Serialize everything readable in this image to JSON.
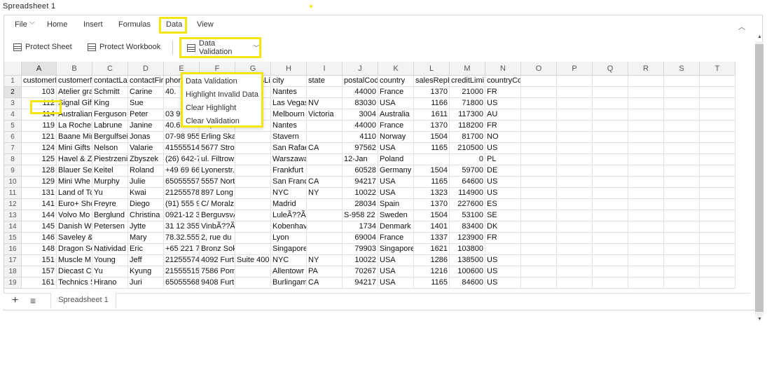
{
  "app": {
    "title": "Spreadsheet 1"
  },
  "menu": {
    "items": [
      "File",
      "Home",
      "Insert",
      "Formulas",
      "Data",
      "View"
    ],
    "active": "Data"
  },
  "toolbar": {
    "protect_sheet": "Protect Sheet",
    "protect_workbook": "Protect Workbook",
    "data_validation": "Data Validation"
  },
  "dropdown": {
    "items": [
      "Data Validation",
      "Highlight Invalid Data",
      "Clear Highlight",
      "Clear Validation"
    ]
  },
  "columns": [
    "A",
    "B",
    "C",
    "D",
    "E",
    "F",
    "G",
    "H",
    "I",
    "J",
    "K",
    "L",
    "M",
    "N",
    "O",
    "P",
    "Q",
    "R",
    "S",
    "T"
  ],
  "rows": [
    [
      "customerN",
      "customerN",
      "contactLa",
      "contactFir",
      "phone",
      "addressLi",
      "addressLi",
      "city",
      "state",
      "postalCod",
      "country",
      "salesRepE",
      "creditLimi",
      "countryCo"
    ],
    [
      "103",
      "Atelier gra",
      "Schmitt",
      "Carine",
      "40.",
      "",
      "",
      "Nantes",
      "",
      "44000",
      "France",
      "1370",
      "21000",
      "FR"
    ],
    [
      "112",
      "Signal Gift",
      "King",
      "Sue",
      "702",
      "",
      "",
      "Las Vegas",
      "NV",
      "83030",
      "USA",
      "1166",
      "71800",
      "US"
    ],
    [
      "114",
      "Australian",
      "Ferguson",
      "Peter",
      "03 9520 4",
      "636 St Kild",
      "Level 3",
      "Melbourn",
      "Victoria",
      "3004",
      "Australia",
      "1611",
      "117300",
      "AU"
    ],
    [
      "119",
      "La Rochell",
      "Labrune",
      "Janine",
      "40.67.855",
      "67, rue de",
      "",
      "Nantes",
      "",
      "44000",
      "France",
      "1370",
      "118200",
      "FR"
    ],
    [
      "121",
      "Baane Mir",
      "Bergulfsei",
      "Jonas",
      "07-98 955",
      "Erling Ska",
      "",
      "Stavern",
      "",
      "4110",
      "Norway",
      "1504",
      "81700",
      "NO"
    ],
    [
      "124",
      "Mini Gifts",
      "Nelson",
      "Valarie",
      "415555145",
      "5677 Stro",
      "",
      "San Rafae",
      "CA",
      "97562",
      "USA",
      "1165",
      "210500",
      "US"
    ],
    [
      "125",
      "Havel & Zi",
      "Piestrzeni",
      "Zbyszek",
      "(26) 642-7",
      "ul. Filtrow",
      "",
      "Warszawa",
      "",
      "12-Jan",
      "Poland",
      "",
      "0",
      "PL"
    ],
    [
      "128",
      "Blauer See",
      "Keitel",
      "Roland",
      "+49 69 66",
      "Lyonerstr.",
      "",
      "Frankfurt",
      "",
      "60528",
      "Germany",
      "1504",
      "59700",
      "DE"
    ],
    [
      "129",
      "Mini Whe",
      "Murphy",
      "Julie",
      "650555578",
      "5557 Nort",
      "",
      "San Franc",
      "CA",
      "94217",
      "USA",
      "1165",
      "64600",
      "US"
    ],
    [
      "131",
      "Land of Tc",
      "Yu",
      "Kwai",
      "212555781",
      "897 Long",
      "",
      "NYC",
      "NY",
      "10022",
      "USA",
      "1323",
      "114900",
      "US"
    ],
    [
      "141",
      "Euro+ Sho",
      "Freyre",
      "Diego",
      "(91) 555 9",
      "C/ Moralz",
      "",
      "Madrid",
      "",
      "28034",
      "Spain",
      "1370",
      "227600",
      "ES"
    ],
    [
      "144",
      "Volvo Mo",
      "Berglund",
      "Christina",
      "0921-12 3",
      "BerguvsvÃ",
      "",
      "LuleÃ??Ã?",
      "",
      "S-958 22",
      "Sweden",
      "1504",
      "53100",
      "SE"
    ],
    [
      "145",
      "Danish Wl",
      "Petersen",
      "Jytte",
      "31 12 355",
      "VinbÃ??Ã?",
      "",
      "Kobenhav",
      "",
      "1734",
      "Denmark",
      "1401",
      "83400",
      "DK"
    ],
    [
      "146",
      "Saveley & Saveley",
      "",
      "Mary",
      "78.32.555",
      "2, rue du",
      "",
      "Lyon",
      "",
      "69004",
      "France",
      "1337",
      "123900",
      "FR"
    ],
    [
      "148",
      "Dragon Sc",
      "Natividad",
      "Eric",
      "+65 221 7",
      "Bronz Sok",
      "",
      "Singapore",
      "",
      "79903",
      "Singapore",
      "1621",
      "103800",
      ""
    ],
    [
      "151",
      "Muscle M",
      "Young",
      "Jeff",
      "212555741",
      "4092 Furt",
      "Suite 400",
      "NYC",
      "NY",
      "10022",
      "USA",
      "1286",
      "138500",
      "US"
    ],
    [
      "157",
      "Diecast Cl",
      "Yu",
      "Kyung",
      "215555151",
      "7586 Pom",
      "",
      "Allentowr",
      "PA",
      "70267",
      "USA",
      "1216",
      "100600",
      "US"
    ],
    [
      "161",
      "Technics S",
      "Hirano",
      "Juri",
      "650555680",
      "9408 Furt",
      "",
      "Burlingam",
      "CA",
      "94217",
      "USA",
      "1165",
      "84600",
      "US"
    ]
  ],
  "sheet_tab": "Spreadsheet 1"
}
